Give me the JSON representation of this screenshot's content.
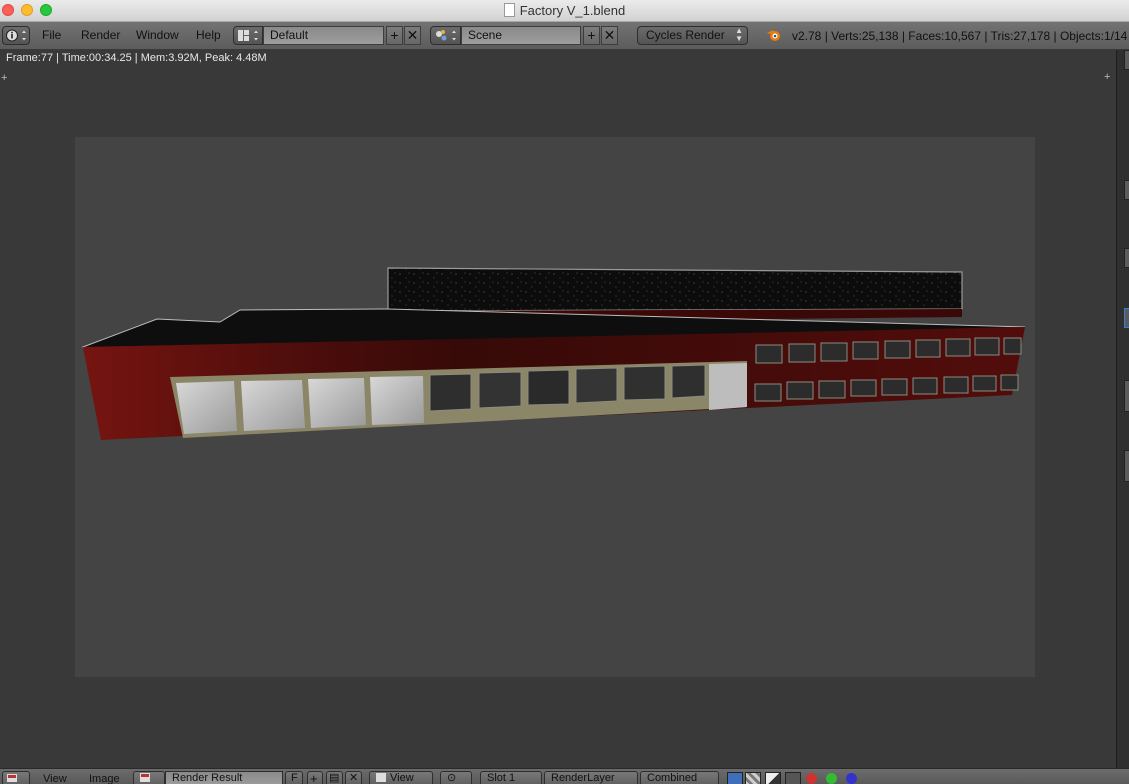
{
  "window": {
    "title": "Factory V_1.blend"
  },
  "menubar": {
    "items": [
      "File",
      "Render",
      "Window",
      "Help"
    ],
    "screen_layout": "Default",
    "scene": "Scene",
    "render_engine": "Cycles Render",
    "stats": "v2.78 | Verts:25,138 | Faces:10,567 | Tris:27,178 | Objects:1/14 |"
  },
  "render_info": "Frame:77 | Time:00:34.25 | Mem:3.92M, Peak: 4.48M",
  "image_editor": {
    "menus": [
      "View",
      "Image"
    ],
    "image_name": "Render Result",
    "fake_user": "F",
    "view_mode": "View",
    "slot": "Slot 1",
    "render_layer": "RenderLayer",
    "pass": "Combined"
  },
  "colors": {
    "wall_red": "#7e1410",
    "roof": "#111111",
    "render_bg": "#444444",
    "editor_bg": "#393939"
  }
}
